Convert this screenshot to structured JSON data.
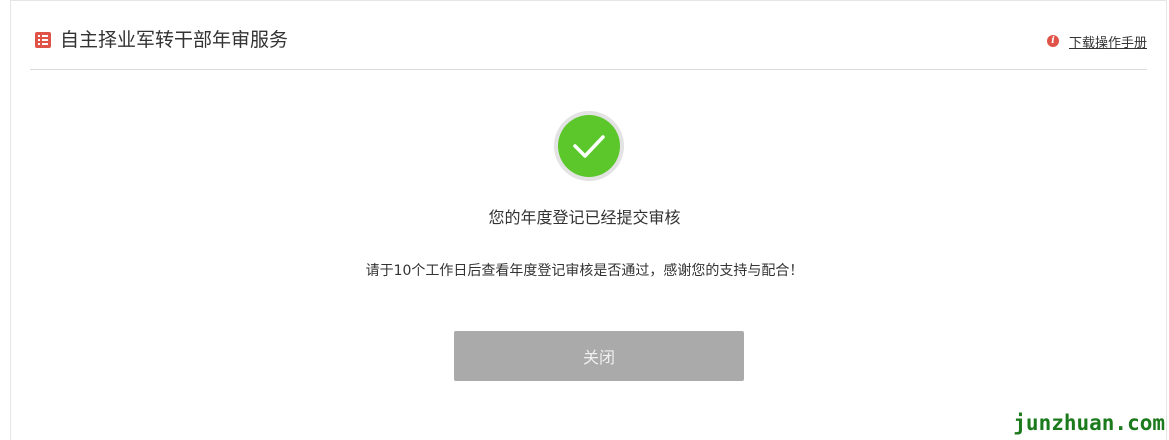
{
  "header": {
    "title": "自主择业军转干部年审服务",
    "title_icon": "list-icon",
    "info_icon": "info-icon",
    "info_icon_glyph": "i",
    "download_label": "下载操作手册"
  },
  "result": {
    "icon": "check-icon",
    "title": "您的年度登记已经提交审核",
    "message": "请于10个工作日后查看年度登记审核是否通过，感谢您的支持与配合！"
  },
  "actions": {
    "close_label": "关闭"
  },
  "watermark": "junzhuan.com",
  "colors": {
    "accent_red": "#e05348",
    "success_green": "#5bc72a",
    "button_gray": "#aaaaaa",
    "watermark_green": "#1b7a1b"
  }
}
